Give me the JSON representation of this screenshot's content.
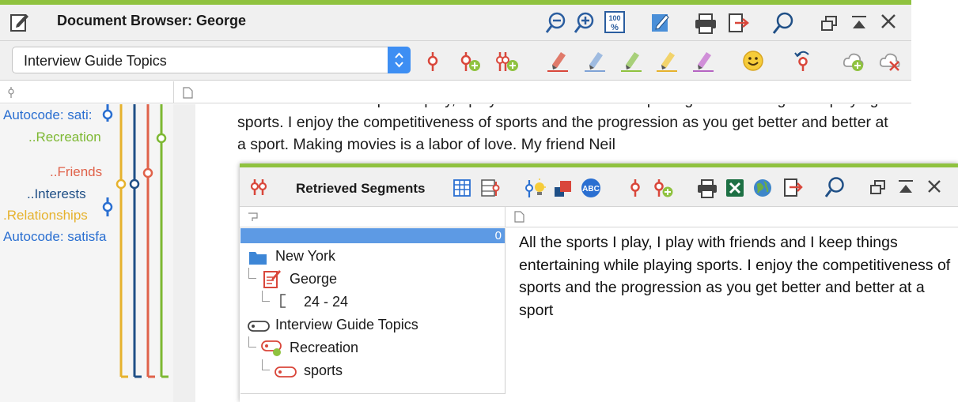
{
  "document_browser": {
    "title": "Document Browser: George",
    "document_set_dropdown": {
      "selected": "Interview Guide Topics"
    },
    "text": "satisfaction. All the sports I play, I play with friends and I keep things entertaining while playing sports. I enjoy the competitiveness of sports and the progression as you get better and better at a sport. Making movies is a labor of love. My friend Neil",
    "code_labels": [
      {
        "label": "Autocode: sati:",
        "color": "#2a6fd1"
      },
      {
        "label": "..Recreation",
        "color": "#7db832"
      },
      {
        "label": "..Friends",
        "color": "#e0624a"
      },
      {
        "label": "..Interests",
        "color": "#1f4f86"
      },
      {
        "label": ".Relationships",
        "color": "#e6b22d"
      },
      {
        "label": "Autocode: satisfa",
        "color": "#2a6fd1"
      }
    ],
    "toolbar_icons": [
      "zoom-out-icon",
      "zoom-in-icon",
      "zoom-100-icon",
      "edit-icon",
      "print-icon",
      "export-icon",
      "search-icon",
      "window-restore-icon",
      "collapse-icon",
      "close-icon"
    ],
    "coding_icons": [
      "code-icon",
      "new-code-icon",
      "new-subcode-icon",
      "highlighter-red-icon",
      "highlighter-blue-icon",
      "highlighter-green-icon",
      "highlighter-yellow-icon",
      "highlighter-purple-icon",
      "emoticode-icon",
      "undo-code-icon",
      "cloud-code-icon",
      "remove-code-icon"
    ]
  },
  "retrieved_segments": {
    "title": "Retrieved Segments",
    "selected_count": "0",
    "tree": [
      {
        "label": "New York",
        "type": "document-group"
      },
      {
        "label": "George",
        "type": "document"
      },
      {
        "label": "24 - 24",
        "type": "segment-range"
      },
      {
        "label": "Interview Guide Topics",
        "type": "document-set"
      },
      {
        "label": "Recreation",
        "type": "code"
      },
      {
        "label": "sports",
        "type": "subcode"
      }
    ],
    "segment_text": "All the sports I play, I play with friends and I keep things entertaining while playing sports. I enjoy the competitiveness of sports and the progression as you get better and better at a sport",
    "toolbar_icons": [
      "table-view-icon",
      "code-matrix-icon",
      "light-bulb-icon",
      "code-color-icon",
      "text-search-icon",
      "code-icon",
      "new-code-icon",
      "print-icon",
      "excel-icon",
      "web-export-icon",
      "export-icon",
      "search-icon",
      "window-restore-icon",
      "collapse-icon",
      "close-icon"
    ]
  },
  "colors": {
    "accent_green": "#8fc23f",
    "selection_blue": "#5d9ae4",
    "dropdown_blue": "#3d8ef3",
    "code_red": "#d9473b"
  }
}
